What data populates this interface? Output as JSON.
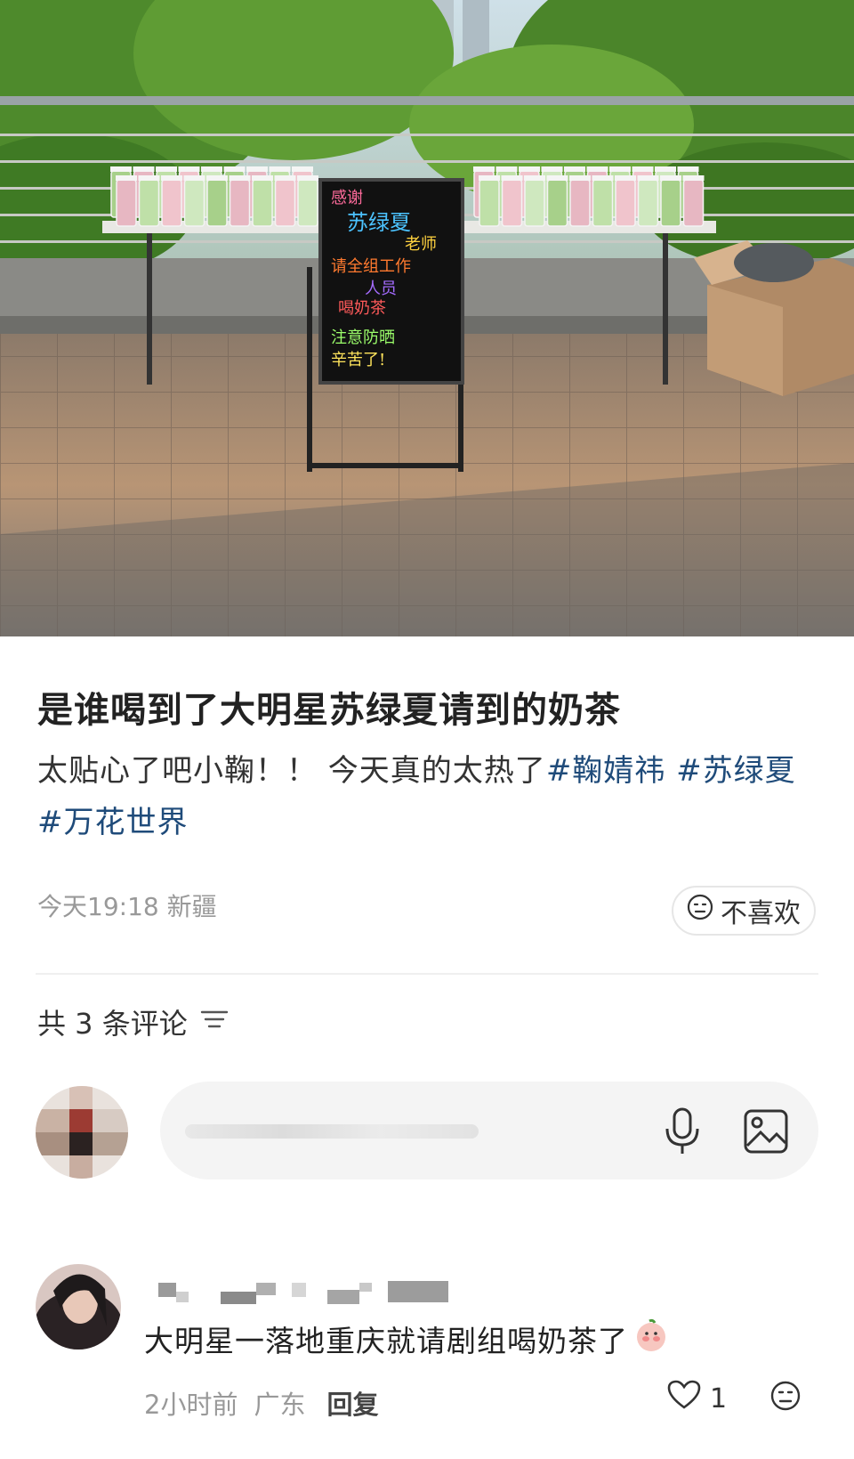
{
  "post": {
    "title": "是谁喝到了大明星苏绿夏请到的奶茶",
    "body_text": "太贴心了吧小鞠！！ 今天真的太热了",
    "tags": [
      "#鞠婧祎",
      "#苏绿夏",
      "#万花世界"
    ],
    "time": "今天19:18",
    "location": "新疆",
    "dislike_label": "不喜欢"
  },
  "photo": {
    "board_lines": [
      "感谢",
      "苏绿夏",
      "老师",
      "请全组工作",
      "人员",
      "喝奶茶",
      "注意防晒",
      "辛苦了!"
    ],
    "board_colors": [
      "#ff6b9b",
      "#4cc3ff",
      "#ffd23f",
      "#ff7a2f",
      "#a46bff",
      "#ff5a5a",
      "#9cff6b",
      "#ffe45c"
    ]
  },
  "comments": {
    "header": "共 3 条评论",
    "composer": {
      "placeholder": ""
    },
    "items": [
      {
        "text": "大明星一落地重庆就请剧组喝奶茶了",
        "time": "2小时前",
        "location": "广东",
        "reply_label": "回复",
        "likes": "1"
      }
    ]
  }
}
